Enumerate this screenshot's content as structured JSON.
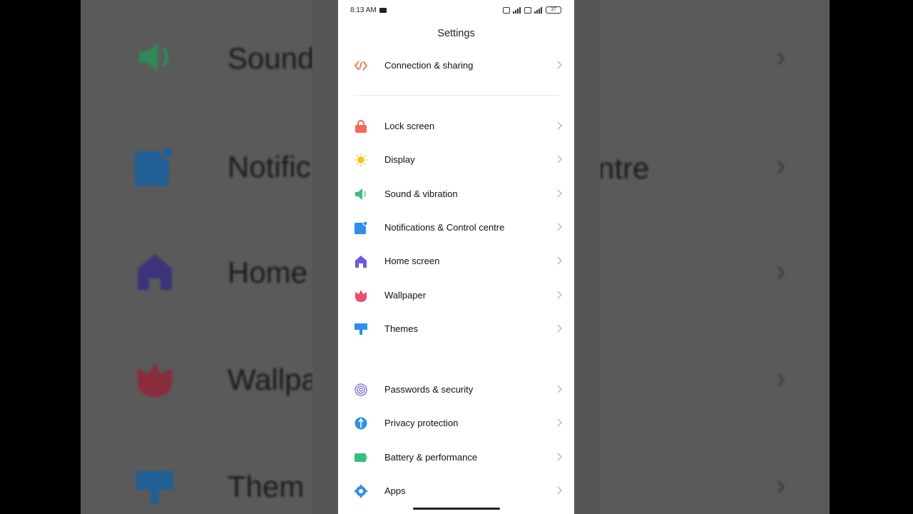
{
  "status_bar": {
    "time": "8:13 AM",
    "battery": "37"
  },
  "header": {
    "title": "Settings"
  },
  "items": [
    {
      "label": "Connection & sharing",
      "icon": "connection-sharing-icon",
      "color": "#f07a5c"
    },
    {
      "label": "Lock screen",
      "icon": "lock-icon",
      "color": "#f26b5b"
    },
    {
      "label": "Display",
      "icon": "sun-icon",
      "color": "#f5c518"
    },
    {
      "label": "Sound & vibration",
      "icon": "speaker-icon",
      "color": "#35c07d"
    },
    {
      "label": "Notifications & Control centre",
      "icon": "notifications-icon",
      "color": "#2f8fe8"
    },
    {
      "label": "Home screen",
      "icon": "home-icon",
      "color": "#6a5be0"
    },
    {
      "label": "Wallpaper",
      "icon": "tulip-icon",
      "color": "#e8506e"
    },
    {
      "label": "Themes",
      "icon": "brush-icon",
      "color": "#2f8fe8"
    },
    {
      "label": "Passwords & security",
      "icon": "fingerprint-icon",
      "color": "#8a7ad6"
    },
    {
      "label": "Privacy protection",
      "icon": "shield-icon",
      "color": "#2f8fe8"
    },
    {
      "label": "Battery & performance",
      "icon": "battery-icon",
      "color": "#35c07d"
    },
    {
      "label": "Apps",
      "icon": "gear-icon",
      "color": "#2f8fe8"
    }
  ],
  "background": {
    "left": [
      "Sound",
      "Notific",
      "Home",
      "Wallpa",
      "Them"
    ],
    "right": [
      "",
      "ntre",
      "",
      "",
      ""
    ]
  }
}
